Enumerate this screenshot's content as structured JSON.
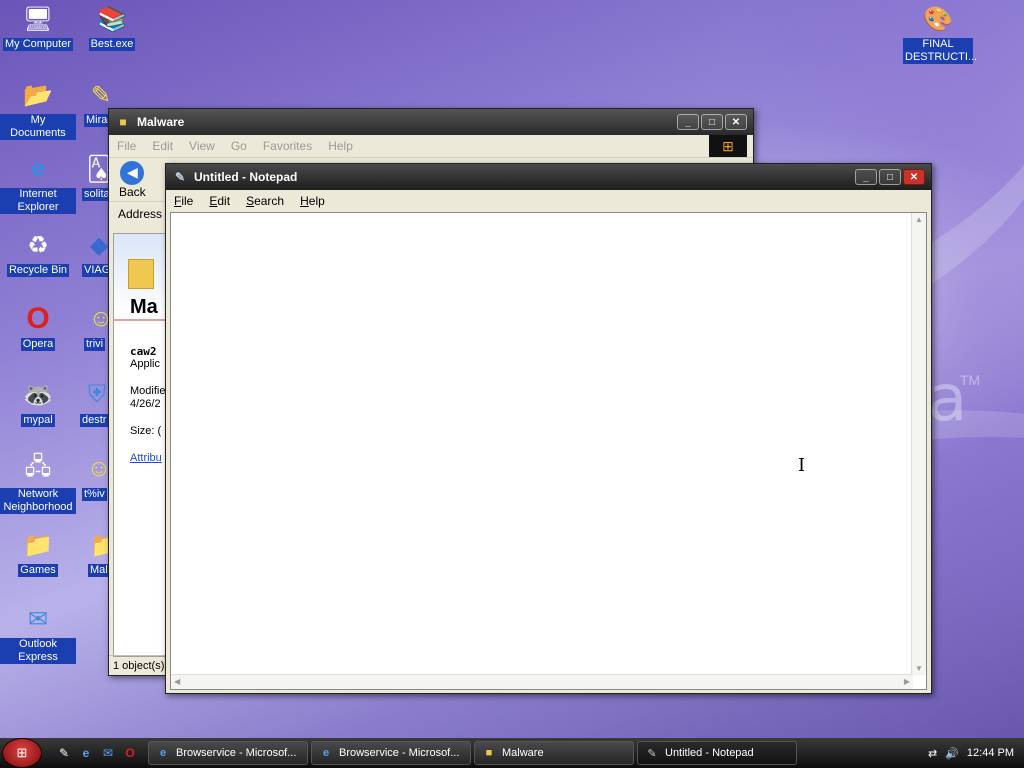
{
  "desktop": {
    "icons": [
      {
        "label": "My Computer",
        "icon": "computer-icon"
      },
      {
        "label": "Best.exe",
        "icon": "winrar-icon"
      },
      {
        "label": "My Documents",
        "icon": "folder-icon"
      },
      {
        "label": "Mirac",
        "icon": "shortcut-icon"
      },
      {
        "label": "Internet Explorer",
        "icon": "ie-icon"
      },
      {
        "label": "solita",
        "icon": "cards-icon"
      },
      {
        "label": "Recycle Bin",
        "icon": "recycle-bin-icon"
      },
      {
        "label": "VIAGR",
        "icon": "pill-icon"
      },
      {
        "label": "Opera",
        "icon": "opera-icon"
      },
      {
        "label": "trivi",
        "icon": "smiley-icon"
      },
      {
        "label": "mypal",
        "icon": "raccoon-icon"
      },
      {
        "label": "destr",
        "icon": "shield-icon"
      },
      {
        "label": "Network Neighborhood",
        "icon": "network-icon"
      },
      {
        "label": "t%iv",
        "icon": "smiley-icon"
      },
      {
        "label": "Games",
        "icon": "folder-icon"
      },
      {
        "label": "Mal",
        "icon": "folder-icon"
      },
      {
        "label": "Outlook Express",
        "icon": "outlook-icon"
      },
      {
        "label": "FINAL DESTRUCTI...",
        "icon": "paint-palette-icon"
      }
    ],
    "wallpaper_text": "a",
    "wallpaper_tm": "TM"
  },
  "malware_window": {
    "title": "Malware",
    "menu": [
      "File",
      "Edit",
      "View",
      "Go",
      "Favorites",
      "Help"
    ],
    "back_label": "Back",
    "address_label": "Address",
    "side_title": "Ma",
    "file_name": "caw2",
    "file_type": "Applic",
    "modified_label": "Modifie",
    "modified_date": "4/26/2",
    "size_label": "Size: (",
    "attributes_link": "Attribu",
    "status": "1 object(s)"
  },
  "notepad_window": {
    "title": "Untitled - Notepad",
    "menu": [
      "File",
      "Edit",
      "Search",
      "Help"
    ],
    "content": ""
  },
  "taskbar": {
    "tasks": [
      {
        "label": "Browservice - Microsof...",
        "icon": "ie-icon"
      },
      {
        "label": "Browservice - Microsof...",
        "icon": "ie-icon"
      },
      {
        "label": "Malware",
        "icon": "folder-icon"
      },
      {
        "label": "Untitled - Notepad",
        "icon": "notepad-icon"
      }
    ],
    "clock": "12:44 PM"
  }
}
